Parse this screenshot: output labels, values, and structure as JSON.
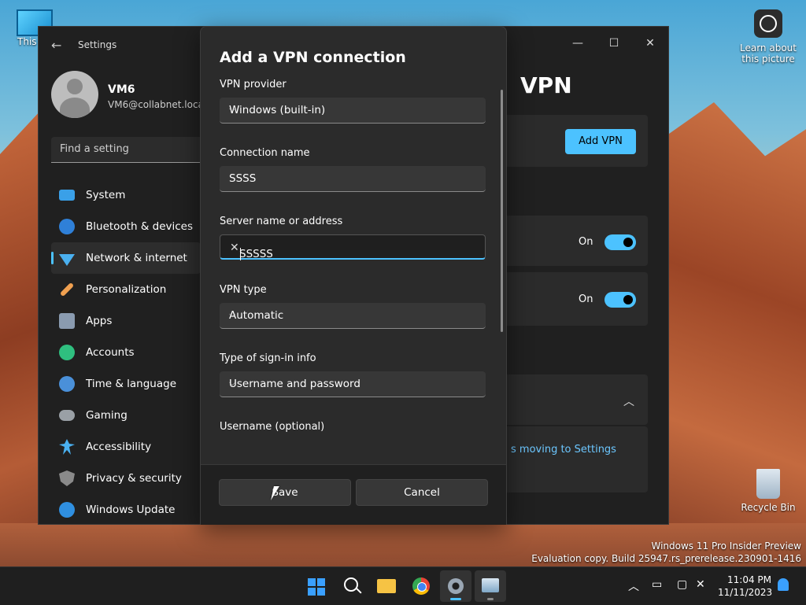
{
  "desktop": {
    "this_pc_label": "This PC",
    "learn_label": "Learn about this picture",
    "recycle_bin_label": "Recycle Bin"
  },
  "settings": {
    "app_title": "Settings",
    "user_name": "VM6",
    "user_email": "VM6@collabnet.local",
    "search_placeholder": "Find a setting",
    "nav": [
      {
        "label": "System",
        "icon": "system-icon"
      },
      {
        "label": "Bluetooth & devices",
        "icon": "bluetooth-icon"
      },
      {
        "label": "Network & internet",
        "icon": "wifi-icon",
        "active": true
      },
      {
        "label": "Personalization",
        "icon": "brush-icon"
      },
      {
        "label": "Apps",
        "icon": "apps-icon"
      },
      {
        "label": "Accounts",
        "icon": "person-icon"
      },
      {
        "label": "Time & language",
        "icon": "globe-clock-icon"
      },
      {
        "label": "Gaming",
        "icon": "controller-icon"
      },
      {
        "label": "Accessibility",
        "icon": "accessibility-icon"
      },
      {
        "label": "Privacy & security",
        "icon": "shield-icon"
      },
      {
        "label": "Windows Update",
        "icon": "update-icon"
      }
    ],
    "content": {
      "title": "VPN",
      "add_vpn_label": "Add VPN",
      "toggle1_label": "On",
      "toggle2_label": "On",
      "link_text": "s moving to Settings"
    }
  },
  "dialog": {
    "title": "Add a VPN connection",
    "vpn_provider_label": "VPN provider",
    "vpn_provider_value": "Windows (built-in)",
    "connection_name_label": "Connection name",
    "connection_name_value": "SSSS",
    "server_label": "Server name or address",
    "server_value": "SSSSS",
    "vpn_type_label": "VPN type",
    "vpn_type_value": "Automatic",
    "signin_label": "Type of sign-in info",
    "signin_value": "Username and password",
    "username_label": "Username (optional)",
    "save_label": "Save",
    "cancel_label": "Cancel"
  },
  "watermark": {
    "line1": "Windows 11 Pro Insider Preview",
    "line2": "Evaluation copy. Build 25947.rs_prerelease.230901-1416"
  },
  "taskbar": {
    "time": "11:04 PM",
    "date": "11/11/2023"
  },
  "colors": {
    "accent": "#4cc2ff",
    "window_bg": "#202020",
    "dialog_bg": "#2b2b2b"
  }
}
